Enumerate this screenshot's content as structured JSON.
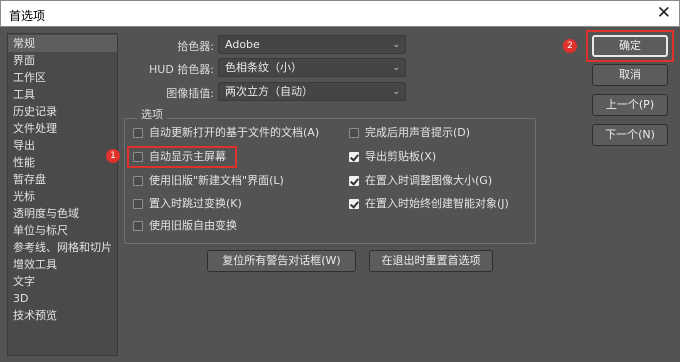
{
  "window": {
    "title": "首选项",
    "close_glyph": "✕"
  },
  "sidebar": {
    "items": [
      {
        "label": "常规"
      },
      {
        "label": "界面"
      },
      {
        "label": "工作区"
      },
      {
        "label": "工具"
      },
      {
        "label": "历史记录"
      },
      {
        "label": "文件处理"
      },
      {
        "label": "导出"
      },
      {
        "label": "性能"
      },
      {
        "label": "暂存盘"
      },
      {
        "label": "光标"
      },
      {
        "label": "透明度与色域"
      },
      {
        "label": "单位与标尺"
      },
      {
        "label": "参考线、网格和切片"
      },
      {
        "label": "增效工具"
      },
      {
        "label": "文字"
      },
      {
        "label": "3D"
      },
      {
        "label": "技术预览"
      }
    ],
    "selected_index": 0
  },
  "settings": {
    "color_picker_label": "拾色器:",
    "color_picker_value": "Adobe",
    "hud_picker_label": "HUD 拾色器:",
    "hud_picker_value": "色相条纹（小）",
    "interpolation_label": "图像插值:",
    "interpolation_value": "两次立方（自动）"
  },
  "options": {
    "title": "选项",
    "items": [
      {
        "label": "自动更新打开的基于文件的文档(A)",
        "checked": false
      },
      {
        "label": "完成后用声音提示(D)",
        "checked": false
      },
      {
        "label": "自动显示主屏幕",
        "checked": false
      },
      {
        "label": "导出剪贴板(X)",
        "checked": true
      },
      {
        "label": "使用旧版\"新建文档\"界面(L)",
        "checked": false
      },
      {
        "label": "在置入时调整图像大小(G)",
        "checked": true
      },
      {
        "label": "置入时跳过变换(K)",
        "checked": false
      },
      {
        "label": "在置入时始终创建智能对象(J)",
        "checked": true
      },
      {
        "label": "使用旧版自由变换",
        "checked": false
      }
    ]
  },
  "actions": {
    "reset_warnings": "复位所有警告对话框(W)",
    "reset_on_quit": "在退出时重置首选项"
  },
  "buttons": {
    "ok": "确定",
    "cancel": "取消",
    "prev": "上一个(P)",
    "next": "下一个(N)"
  },
  "annotations": {
    "badge_1": "1",
    "badge_2": "2",
    "highlight_color": "#e0322d"
  }
}
